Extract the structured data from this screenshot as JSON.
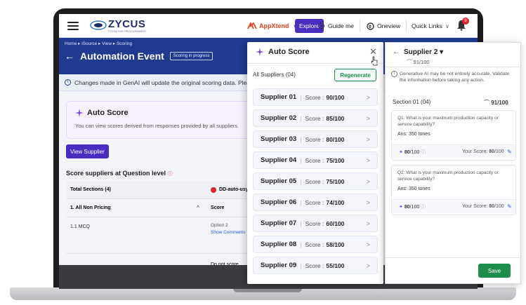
{
  "topnav": {
    "logo": "ZYCUS",
    "logo_sub": "COGNITIVE PROCUREMENT",
    "appxtend": "AppXtend",
    "explore": "Explore",
    "guide_me": "Guide me",
    "oneview": "Oneview",
    "quick_links": "Quick Links",
    "notification_count": "9"
  },
  "header": {
    "breadcrumb": "Home  ▸  iSource  ▸  View  ▸  Scoring",
    "title": "Automation Event",
    "status": "Scoring in progress"
  },
  "info_bar": {
    "text": "Changes made in GenAI will update the original scoring data. Please save be"
  },
  "auto_score_card": {
    "title": "Auto Score",
    "description": "You can view scores derived from responses provided by all suppliers."
  },
  "view_supplier_button": "View Supplier",
  "score_question_title": "Score suppliers at Question level",
  "table": {
    "head_col1": "Total Sections (4)",
    "head_col2": "DD-auto-usy",
    "group_col1": "1. All Non Pricing",
    "group_col2": "Score",
    "item_label": "1.1 MCQ",
    "option": "Option 2",
    "show_comments": "Show Comments",
    "do_not_score": "Do not score"
  },
  "auto_score_panel": {
    "title": "Auto Score",
    "all_suppliers": "All Suppliers (04)",
    "regenerate": "Regenerate",
    "score_label": "Score :",
    "suppliers": [
      {
        "name": "Supplier 01",
        "score": "90/100"
      },
      {
        "name": "Supplier 02",
        "score": "85/100"
      },
      {
        "name": "Supplier 03",
        "score": "80/100"
      },
      {
        "name": "Supplier 04",
        "score": "75/100"
      },
      {
        "name": "Supplier 05",
        "score": "75/100"
      },
      {
        "name": "Supplier 06",
        "score": "74/100"
      },
      {
        "name": "Supplier 07",
        "score": "60/100"
      },
      {
        "name": "Supplier 08",
        "score": "58/100"
      },
      {
        "name": "Supplier 09",
        "score": "55/100"
      }
    ]
  },
  "supplier_panel": {
    "title": "Supplier 2",
    "overall": "91/100",
    "warning": "Generative AI may be not entirely accurate. Validate the information before taking any action.",
    "section": "Section 01 (04)",
    "section_score": "91/100",
    "questions": [
      {
        "q": "Q1: What is your maximum production capacity or service capability?",
        "ans": "Ans: 350 tones",
        "ai_score": "80",
        "ai_total": "/100",
        "your_label": "Your Score:",
        "your_score": "80",
        "your_total": "/100"
      },
      {
        "q": "Q2: What is your maximum production capacity or service capability?",
        "ans": "Ans: 350 tones",
        "ai_score": "80",
        "ai_total": "/100",
        "your_label": "Your Score:",
        "your_score": "80",
        "your_total": "/100"
      }
    ],
    "save": "Save"
  }
}
